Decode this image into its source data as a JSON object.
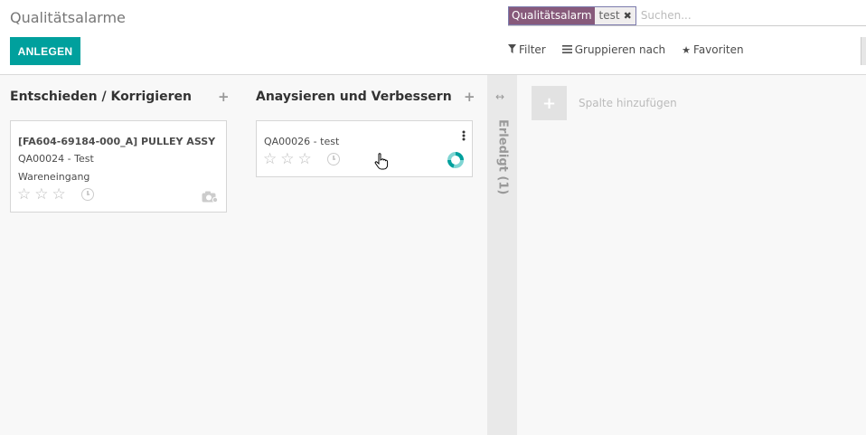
{
  "breadcrumb": "Qualitätsalarme",
  "create_button": "ANLEGEN",
  "search": {
    "facet_label": "Qualitätsalarm",
    "facet_value": "test",
    "placeholder": "Suchen..."
  },
  "filters": {
    "filter": "Filter",
    "group_by": "Gruppieren nach",
    "favorites": "Favoriten"
  },
  "columns": [
    {
      "title": "Entschieden / Korrigieren",
      "cards": [
        {
          "title": "[FA604-69184-000_A] PULLEY ASSY",
          "ref": "QA00024 - Test",
          "team": "Wareneingang"
        }
      ]
    },
    {
      "title": "Anaysieren und Verbessern",
      "cards": [
        {
          "ref": "QA00026 - test"
        }
      ]
    }
  ],
  "folded_column": {
    "label": "Erledigt (1)"
  },
  "add_column_label": "Spalte hinzufügen",
  "colors": {
    "primary": "#00a09d",
    "facet": "#875a7b"
  }
}
